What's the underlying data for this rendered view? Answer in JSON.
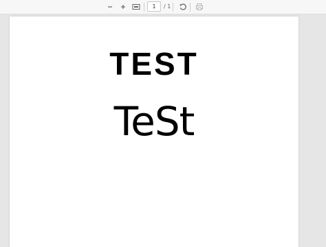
{
  "toolbar": {
    "zoom_out_icon": "minus-icon",
    "zoom_in_icon": "plus-icon",
    "fit_icon": "fit-page-icon",
    "page_current": "1",
    "page_total": "/ 1",
    "rotate_icon": "rotate-ccw-icon",
    "print_icon": "print-icon"
  },
  "document": {
    "heading": "TEST",
    "subheading": "TeSt"
  }
}
